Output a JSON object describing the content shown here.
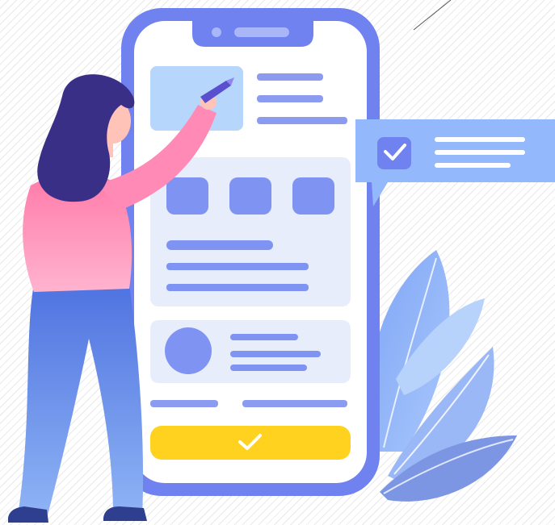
{
  "illustration": {
    "subject": "person-using-phone-app",
    "colors": {
      "phone_frame": "#6f82ef",
      "screen": "#ffffff",
      "card": "#e8edfb",
      "tile": "#7f93f2",
      "line": "#8b9cf0",
      "image_block": "#b7d6fb",
      "confirm_button": "#ffd21f",
      "bubble": "#93b8fb",
      "shirt": "#ff86b3",
      "pants": "#5d86e6",
      "hair": "#3a2f86",
      "skin": "#ffc3b8"
    },
    "icons": [
      "checkbox-icon",
      "checkmark-icon",
      "pencil-icon",
      "leaf-icon"
    ]
  }
}
